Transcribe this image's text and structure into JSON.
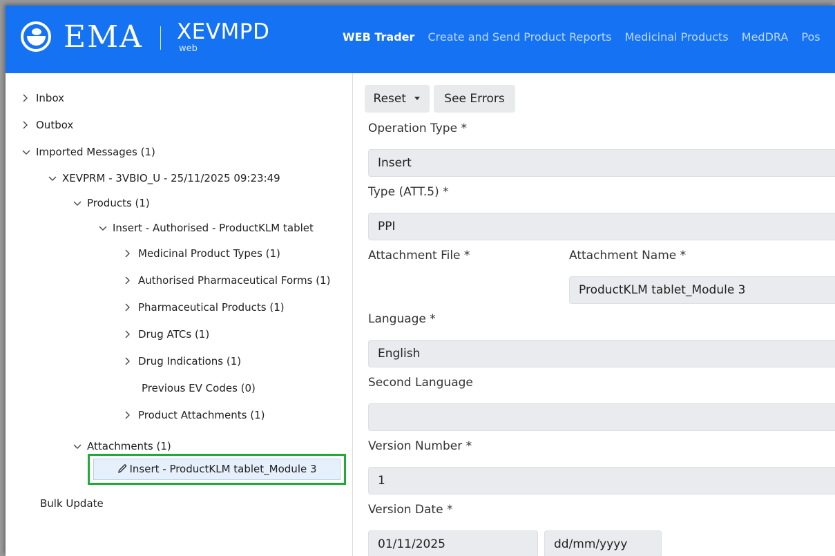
{
  "header": {
    "logo_ema": "EMA",
    "logo_app": "XEVMPD",
    "logo_sub": "web",
    "nav": [
      "WEB Trader",
      "Create and Send Product Reports",
      "Medicinal Products",
      "MedDRA",
      "Pos"
    ]
  },
  "tree": {
    "inbox": "Inbox",
    "outbox": "Outbox",
    "imported": "Imported Messages (1)",
    "message": "XEVPRM - 3VBIO_U - 25/11/2025 09:23:49",
    "products": "Products (1)",
    "product": "Insert - Authorised - ProductKLM tablet",
    "medicinal_product_types": "Medicinal Product Types (1)",
    "pharma_forms": "Authorised Pharmaceutical Forms (1)",
    "pharma_products": "Pharmaceutical Products (1)",
    "drug_atcs": "Drug ATCs (1)",
    "drug_indications": "Drug Indications (1)",
    "previous_ev_codes": "Previous EV Codes (0)",
    "product_attachments": "Product Attachments (1)",
    "attachments": "Attachments (1)",
    "selected_attachment": "Insert - ProductKLM tablet_Module 3",
    "bulk_update": "Bulk Update"
  },
  "toolbar": {
    "reset": "Reset",
    "see_errors": "See Errors"
  },
  "form": {
    "operation_type_label": "Operation Type *",
    "operation_type_value": "Insert",
    "type_label": "Type (ATT.5) *",
    "type_value": "PPI",
    "attachment_file_label": "Attachment File *",
    "attachment_name_label": "Attachment Name *",
    "attachment_name_value": "ProductKLM tablet_Module 3",
    "language_label": "Language *",
    "language_value": "English",
    "second_language_label": "Second Language",
    "second_language_value": "",
    "version_number_label": "Version Number *",
    "version_number_value": "1",
    "version_date_label": "Version Date *",
    "version_date_value": "01/11/2025",
    "version_date_format": "dd/mm/yyyy"
  }
}
